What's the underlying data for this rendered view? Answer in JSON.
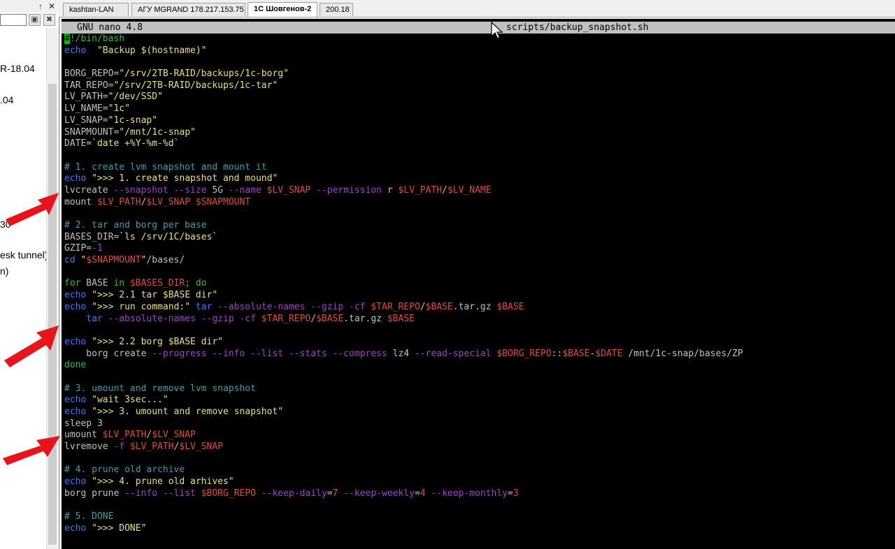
{
  "left_panel": {
    "header_buttons": [
      "↑",
      "✕"
    ],
    "items": [
      "R-18.04",
      ".04",
      "30",
      "esk tunnel)",
      "n)"
    ]
  },
  "tabs": [
    {
      "label": "kashtan-LAN",
      "active": false
    },
    {
      "label": "АГУ MGRAND 178.217.153.75",
      "active": false
    },
    {
      "label": "1С Шовгенов-2",
      "active": true
    },
    {
      "label": "200.18",
      "active": false
    }
  ],
  "editor": {
    "version": "GNU nano 4.8",
    "filename": "scripts/backup_snapshot.sh"
  },
  "code_lines": [
    [
      [
        "cursor",
        "#"
      ],
      [
        "fl",
        "!/bin/bash"
      ]
    ],
    [
      [
        "kw",
        "echo"
      ],
      [
        "",
        "  "
      ],
      [
        "str",
        "\"Backup $(hostname)\""
      ]
    ],
    [],
    [
      [
        "",
        "BORG_REPO="
      ],
      [
        "str",
        "\"/srv/2TB-RAID/backups/1c-borg\""
      ]
    ],
    [
      [
        "",
        "TAR_REPO="
      ],
      [
        "str",
        "\"/srv/2TB-RAID/backups/1c-tar\""
      ]
    ],
    [
      [
        "",
        "LV_PATH="
      ],
      [
        "str",
        "\"/dev/SSD\""
      ]
    ],
    [
      [
        "",
        "LV_NAME="
      ],
      [
        "str",
        "\"1c\""
      ]
    ],
    [
      [
        "",
        "LV_SNAP="
      ],
      [
        "str",
        "\"1c-snap\""
      ]
    ],
    [
      [
        "",
        "SNAPMOUNT="
      ],
      [
        "str",
        "\"/mnt/1c-snap\""
      ]
    ],
    [
      [
        "",
        "DATE="
      ],
      [
        "str",
        "`date +%Y-%m-%d`"
      ]
    ],
    [],
    [
      [
        "cmt",
        "# 1. create lvm snapshot and mount it"
      ]
    ],
    [
      [
        "kw",
        "echo"
      ],
      [
        "",
        ""
      ],
      [
        "str",
        " \">>> 1. create snapshot and mound\""
      ]
    ],
    [
      [
        "",
        "lvcreate "
      ],
      [
        "opt",
        "--snapshot"
      ],
      [
        "",
        " "
      ],
      [
        "opt",
        "--size"
      ],
      [
        "",
        " 5G "
      ],
      [
        "opt",
        "--name"
      ],
      [
        "",
        " "
      ],
      [
        "var",
        "$LV_SNAP"
      ],
      [
        "",
        " "
      ],
      [
        "opt",
        "--permission"
      ],
      [
        "",
        " r "
      ],
      [
        "var",
        "$LV_PATH"
      ],
      [
        "",
        "/"
      ],
      [
        "var",
        "$LV_NAME"
      ]
    ],
    [
      [
        "",
        "mount "
      ],
      [
        "var",
        "$LV_PATH"
      ],
      [
        "",
        "/"
      ],
      [
        "var",
        "$LV_SNAP"
      ],
      [
        "",
        " "
      ],
      [
        "var",
        "$SNAPMOUNT"
      ]
    ],
    [],
    [
      [
        "cmt",
        "# 2. tar and borg per base"
      ]
    ],
    [
      [
        "",
        "BASES_DIR="
      ],
      [
        "str",
        "`ls /srv/1C/bases`"
      ]
    ],
    [
      [
        "",
        "GZIP="
      ],
      [
        "opt",
        "-1"
      ]
    ],
    [
      [
        "kw",
        "cd"
      ],
      [
        "",
        " "
      ],
      [
        "str",
        "\""
      ],
      [
        "var",
        "$SNAPMOUNT"
      ],
      [
        "str",
        "\""
      ],
      [
        "",
        "/bases/"
      ]
    ],
    [],
    [
      [
        "fl",
        "for"
      ],
      [
        "",
        " BASE "
      ],
      [
        "fl",
        "in"
      ],
      [
        "",
        " "
      ],
      [
        "var",
        "$BASES_DIR"
      ],
      [
        "fl",
        "; do"
      ]
    ],
    [
      [
        "kw",
        "echo"
      ],
      [
        "",
        " "
      ],
      [
        "str",
        "\">>> 2.1 tar $BASE dir\""
      ]
    ],
    [
      [
        "kw",
        "echo"
      ],
      [
        "",
        " "
      ],
      [
        "str",
        "\">>> run command:\""
      ],
      [
        "",
        " "
      ],
      [
        "kw",
        "tar"
      ],
      [
        "",
        " "
      ],
      [
        "opt",
        "--absolute-names"
      ],
      [
        "",
        " "
      ],
      [
        "opt",
        "--gzip"
      ],
      [
        "",
        " "
      ],
      [
        "opt",
        "-cf"
      ],
      [
        "",
        " "
      ],
      [
        "var",
        "$TAR_REPO"
      ],
      [
        "",
        "/"
      ],
      [
        "var",
        "$BASE"
      ],
      [
        "",
        ".tar.gz "
      ],
      [
        "var",
        "$BASE"
      ]
    ],
    [
      [
        "",
        "    "
      ],
      [
        "kw",
        "tar"
      ],
      [
        "",
        " "
      ],
      [
        "opt",
        "--absolute-names"
      ],
      [
        "",
        " "
      ],
      [
        "opt",
        "--gzip"
      ],
      [
        "",
        " "
      ],
      [
        "opt",
        "-cf"
      ],
      [
        "",
        " "
      ],
      [
        "var",
        "$TAR_REPO"
      ],
      [
        "",
        "/"
      ],
      [
        "var",
        "$BASE"
      ],
      [
        "",
        ".tar.gz "
      ],
      [
        "var",
        "$BASE"
      ]
    ],
    [],
    [
      [
        "kw",
        "echo"
      ],
      [
        "",
        " "
      ],
      [
        "str",
        "\">>> 2.2 borg $BASE dir\""
      ]
    ],
    [
      [
        "",
        "    borg create "
      ],
      [
        "opt",
        "--progress"
      ],
      [
        "",
        " "
      ],
      [
        "opt",
        "--info"
      ],
      [
        "",
        " "
      ],
      [
        "opt",
        "--list"
      ],
      [
        "",
        " "
      ],
      [
        "opt",
        "--stats"
      ],
      [
        "",
        " "
      ],
      [
        "opt",
        "--compress"
      ],
      [
        "",
        " lz4 "
      ],
      [
        "opt",
        "--read-special"
      ],
      [
        "",
        " "
      ],
      [
        "var",
        "$BORG_REPO"
      ],
      [
        "",
        "::"
      ],
      [
        "var",
        "$BASE"
      ],
      [
        "",
        "-"
      ],
      [
        "var",
        "$DATE"
      ],
      [
        "",
        " /mnt/1c-snap/bases/ZP"
      ]
    ],
    [
      [
        "fl",
        "done"
      ]
    ],
    [],
    [
      [
        "cmt",
        "# 3. umount and remove lvm snapshot"
      ]
    ],
    [
      [
        "kw",
        "echo"
      ],
      [
        "",
        " "
      ],
      [
        "str",
        "\"wait 3sec...\""
      ]
    ],
    [
      [
        "kw",
        "echo"
      ],
      [
        "",
        " "
      ],
      [
        "str",
        "\">>> 3. umount and remove snapshot\""
      ]
    ],
    [
      [
        "",
        "sleep 3"
      ]
    ],
    [
      [
        "",
        "umount "
      ],
      [
        "var",
        "$LV_PATH"
      ],
      [
        "",
        "/"
      ],
      [
        "var",
        "$LV_SNAP"
      ]
    ],
    [
      [
        "",
        "lvremove "
      ],
      [
        "opt",
        "-f"
      ],
      [
        "",
        " "
      ],
      [
        "var",
        "$LV_PATH"
      ],
      [
        "",
        "/"
      ],
      [
        "var",
        "$LV_SNAP"
      ]
    ],
    [],
    [
      [
        "cmt",
        "# 4. prune old archive"
      ]
    ],
    [
      [
        "kw",
        "echo"
      ],
      [
        "",
        " "
      ],
      [
        "str",
        "\">>> 4. prune old arhives\""
      ]
    ],
    [
      [
        "",
        "borg prune "
      ],
      [
        "opt",
        "--info"
      ],
      [
        "",
        " "
      ],
      [
        "opt",
        "--list"
      ],
      [
        "",
        " "
      ],
      [
        "var",
        "$BORG_REPO"
      ],
      [
        "",
        " "
      ],
      [
        "opt",
        "--keep-daily"
      ],
      [
        "",
        "="
      ],
      [
        "var",
        "7"
      ],
      [
        "",
        " "
      ],
      [
        "opt",
        "--keep-weekly"
      ],
      [
        "",
        "="
      ],
      [
        "var",
        "4"
      ],
      [
        "",
        " "
      ],
      [
        "opt",
        "--keep-monthly"
      ],
      [
        "",
        "="
      ],
      [
        "var",
        "3"
      ]
    ],
    [],
    [
      [
        "cmt",
        "# 5. DONE"
      ]
    ],
    [
      [
        "kw",
        "echo"
      ],
      [
        "",
        " "
      ],
      [
        "str",
        "\">>> DONE\""
      ]
    ]
  ]
}
